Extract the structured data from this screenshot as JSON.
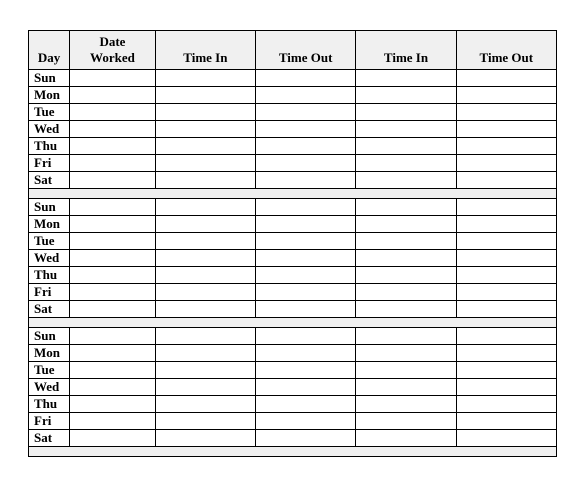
{
  "headers": {
    "day": "Day",
    "date_worked": "Date\nWorked",
    "time_in_1": "Time In",
    "time_out_1": "Time Out",
    "time_in_2": "Time In",
    "time_out_2": "Time Out"
  },
  "weeks": [
    {
      "rows": [
        {
          "day": "Sun",
          "date_worked": "",
          "time_in_1": "",
          "time_out_1": "",
          "time_in_2": "",
          "time_out_2": ""
        },
        {
          "day": "Mon",
          "date_worked": "",
          "time_in_1": "",
          "time_out_1": "",
          "time_in_2": "",
          "time_out_2": ""
        },
        {
          "day": "Tue",
          "date_worked": "",
          "time_in_1": "",
          "time_out_1": "",
          "time_in_2": "",
          "time_out_2": ""
        },
        {
          "day": "Wed",
          "date_worked": "",
          "time_in_1": "",
          "time_out_1": "",
          "time_in_2": "",
          "time_out_2": ""
        },
        {
          "day": "Thu",
          "date_worked": "",
          "time_in_1": "",
          "time_out_1": "",
          "time_in_2": "",
          "time_out_2": ""
        },
        {
          "day": "Fri",
          "date_worked": "",
          "time_in_1": "",
          "time_out_1": "",
          "time_in_2": "",
          "time_out_2": ""
        },
        {
          "day": "Sat",
          "date_worked": "",
          "time_in_1": "",
          "time_out_1": "",
          "time_in_2": "",
          "time_out_2": ""
        }
      ]
    },
    {
      "rows": [
        {
          "day": "Sun",
          "date_worked": "",
          "time_in_1": "",
          "time_out_1": "",
          "time_in_2": "",
          "time_out_2": ""
        },
        {
          "day": "Mon",
          "date_worked": "",
          "time_in_1": "",
          "time_out_1": "",
          "time_in_2": "",
          "time_out_2": ""
        },
        {
          "day": "Tue",
          "date_worked": "",
          "time_in_1": "",
          "time_out_1": "",
          "time_in_2": "",
          "time_out_2": ""
        },
        {
          "day": "Wed",
          "date_worked": "",
          "time_in_1": "",
          "time_out_1": "",
          "time_in_2": "",
          "time_out_2": ""
        },
        {
          "day": "Thu",
          "date_worked": "",
          "time_in_1": "",
          "time_out_1": "",
          "time_in_2": "",
          "time_out_2": ""
        },
        {
          "day": "Fri",
          "date_worked": "",
          "time_in_1": "",
          "time_out_1": "",
          "time_in_2": "",
          "time_out_2": ""
        },
        {
          "day": "Sat",
          "date_worked": "",
          "time_in_1": "",
          "time_out_1": "",
          "time_in_2": "",
          "time_out_2": ""
        }
      ]
    },
    {
      "rows": [
        {
          "day": "Sun",
          "date_worked": "",
          "time_in_1": "",
          "time_out_1": "",
          "time_in_2": "",
          "time_out_2": ""
        },
        {
          "day": "Mon",
          "date_worked": "",
          "time_in_1": "",
          "time_out_1": "",
          "time_in_2": "",
          "time_out_2": ""
        },
        {
          "day": "Tue",
          "date_worked": "",
          "time_in_1": "",
          "time_out_1": "",
          "time_in_2": "",
          "time_out_2": ""
        },
        {
          "day": "Wed",
          "date_worked": "",
          "time_in_1": "",
          "time_out_1": "",
          "time_in_2": "",
          "time_out_2": ""
        },
        {
          "day": "Thu",
          "date_worked": "",
          "time_in_1": "",
          "time_out_1": "",
          "time_in_2": "",
          "time_out_2": ""
        },
        {
          "day": "Fri",
          "date_worked": "",
          "time_in_1": "",
          "time_out_1": "",
          "time_in_2": "",
          "time_out_2": ""
        },
        {
          "day": "Sat",
          "date_worked": "",
          "time_in_1": "",
          "time_out_1": "",
          "time_in_2": "",
          "time_out_2": ""
        }
      ]
    }
  ]
}
